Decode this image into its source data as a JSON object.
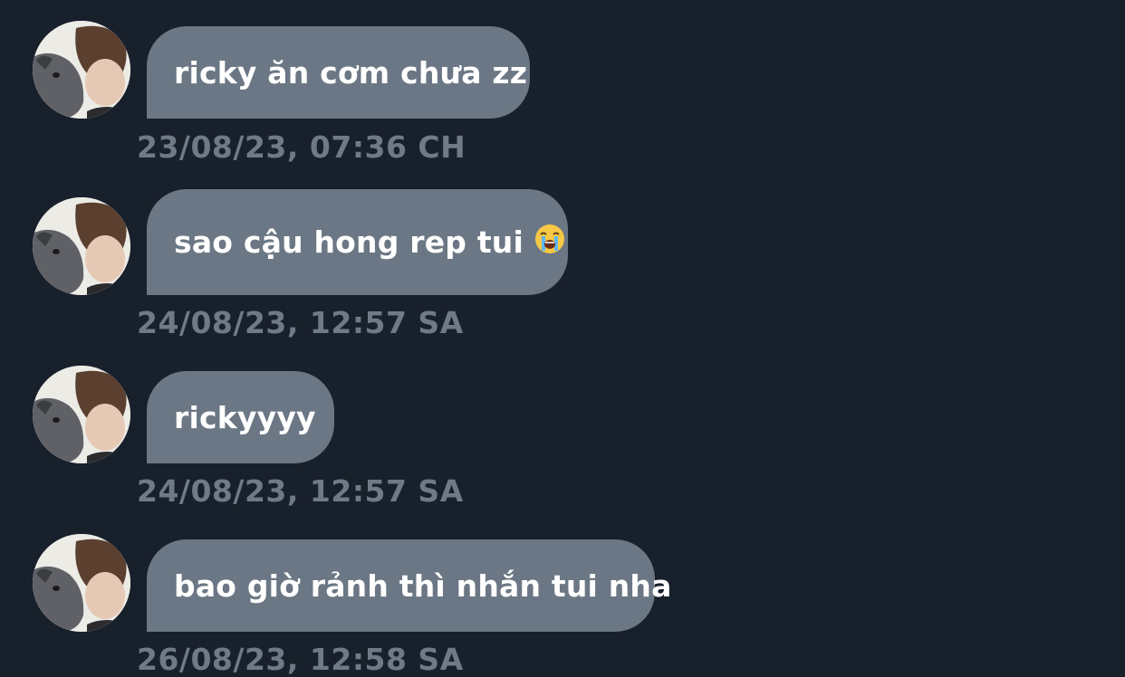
{
  "messages": [
    {
      "text": "ricky ăn cơm chưa zz",
      "timestamp": "23/08/23, 07:36 CH",
      "emoji": ""
    },
    {
      "text": "sao cậu hong rep tui",
      "timestamp": "24/08/23, 12:57 SA",
      "emoji": "loudly-crying-face-icon"
    },
    {
      "text": "rickyyyy",
      "timestamp": "24/08/23, 12:57 SA",
      "emoji": ""
    },
    {
      "text": "bao giờ rảnh thì nhắn tui nha",
      "timestamp": "26/08/23, 12:58 SA",
      "emoji": ""
    }
  ],
  "colors": {
    "background": "#18202b",
    "bubble": "#6b7784",
    "bubble_text": "#ffffff",
    "timestamp": "#6f7a86"
  }
}
